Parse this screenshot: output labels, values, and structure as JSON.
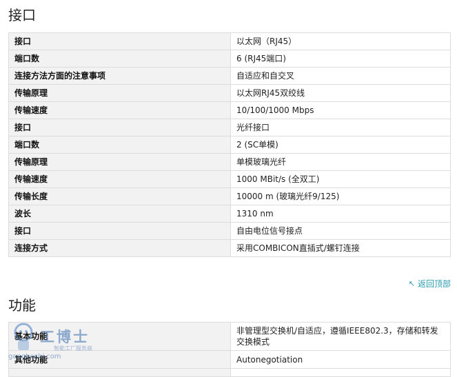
{
  "sections": {
    "interface": {
      "title": "接口",
      "rows": [
        {
          "key": "接口",
          "value": "以太网（RJ45）"
        },
        {
          "key": "端口数",
          "value": "6 (RJ45端口)"
        },
        {
          "key": "连接方法方面的注意事项",
          "value": "自适应和自交叉"
        },
        {
          "key": "传输原理",
          "value": "以太网RJ45双绞线"
        },
        {
          "key": "传输速度",
          "value": "10/100/1000 Mbps"
        },
        {
          "key": "接口",
          "value": "光纤接口"
        },
        {
          "key": "端口数",
          "value": "2 (SC单模)"
        },
        {
          "key": "传输原理",
          "value": "单模玻璃光纤"
        },
        {
          "key": "传输速度",
          "value": "1000 MBit/s (全双工)"
        },
        {
          "key": "传输长度",
          "value": "10000 m (玻璃光纤9/125)"
        },
        {
          "key": "波长",
          "value": "1310 nm"
        },
        {
          "key": "接口",
          "value": "自由电位信号接点"
        },
        {
          "key": "连接方式",
          "value": "采用COMBICON直插式/螺钉连接"
        }
      ]
    },
    "function": {
      "title": "功能",
      "rows": [
        {
          "key": "基本功能",
          "value": "非管理型交换机/自适应，遵循IEEE802.3，存储和转发交换模式"
        },
        {
          "key": "其他功能",
          "value": "Autonegotiation"
        },
        {
          "key": "",
          "value": ""
        }
      ]
    }
  },
  "back_to_top": {
    "label": "返回顶部",
    "icon": "up-arrow-icon"
  },
  "watermark": {
    "brand": "工博士",
    "tagline": "智能工厂服务商",
    "url": "gongboshi.com"
  },
  "colors": {
    "key_bg": "#f2f2f2",
    "border": "#dcdcdc",
    "link": "#2a9bb0"
  }
}
